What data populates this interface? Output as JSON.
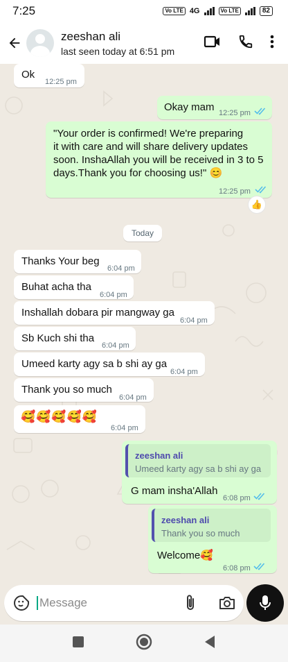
{
  "status_bar": {
    "time": "7:25",
    "network": "4G",
    "volte": "Vo LTE",
    "battery": "82"
  },
  "header": {
    "contact_name": "zeeshan ali",
    "last_seen": "last seen today at 6:51 pm",
    "icons": [
      "back-arrow-icon",
      "avatar",
      "video-call-icon",
      "phone-icon",
      "more-vert-icon"
    ]
  },
  "messages": [
    {
      "dir": "in",
      "text": "Ok",
      "time": "12:25 pm"
    },
    {
      "dir": "out",
      "text": "Okay mam",
      "time": "12:25 pm",
      "status": "read"
    },
    {
      "dir": "out",
      "lines": [
        "\"Your order is confirmed! We're preparing",
        "it with care and will share delivery updates",
        "soon. InshaAllah you will be received in 3 to 5",
        "days.Thank you for choosing us!\" 😊"
      ],
      "time": "12:25 pm",
      "status": "read",
      "reaction": "👍"
    },
    {
      "dir": "in",
      "text": "Thanks Your beg",
      "time": "6:04 pm"
    },
    {
      "dir": "in",
      "text": "Buhat acha tha",
      "time": "6:04 pm"
    },
    {
      "dir": "in",
      "text": "Inshallah dobara pir mangway ga",
      "time": "6:04 pm"
    },
    {
      "dir": "in",
      "text": "Sb Kuch shi tha",
      "time": "6:04 pm"
    },
    {
      "dir": "in",
      "text": "Umeed karty agy sa b shi ay ga",
      "time": "6:04 pm"
    },
    {
      "dir": "in",
      "text": "Thank you so much",
      "time": "6:04 pm"
    },
    {
      "dir": "in",
      "text": "🥰🥰🥰🥰🥰",
      "time": "6:04 pm"
    },
    {
      "dir": "out",
      "quote_name": "zeeshan ali",
      "quote_text": "Umeed karty agy sa b shi ay ga",
      "text": "G mam insha'Allah",
      "time": "6:08 pm",
      "status": "read"
    },
    {
      "dir": "out",
      "quote_name": "zeeshan ali",
      "quote_text": "Thank you so much",
      "text": "Welcome🥰",
      "time": "6:08 pm",
      "status": "read"
    }
  ],
  "date_divider": "Today",
  "composer": {
    "placeholder": "Message",
    "value": "",
    "icons": [
      "emoji-sticker-icon",
      "attach-icon",
      "camera-icon",
      "mic-icon"
    ]
  },
  "nav": {
    "icons": [
      "recents-square-icon",
      "home-circle-icon",
      "back-triangle-icon"
    ]
  },
  "colors": {
    "chat_bg": "#efeae2",
    "outgoing": "#d9fdd3",
    "incoming": "#ffffff",
    "read_ticks": "#53bdeb",
    "quote_accent": "#5350ae"
  }
}
